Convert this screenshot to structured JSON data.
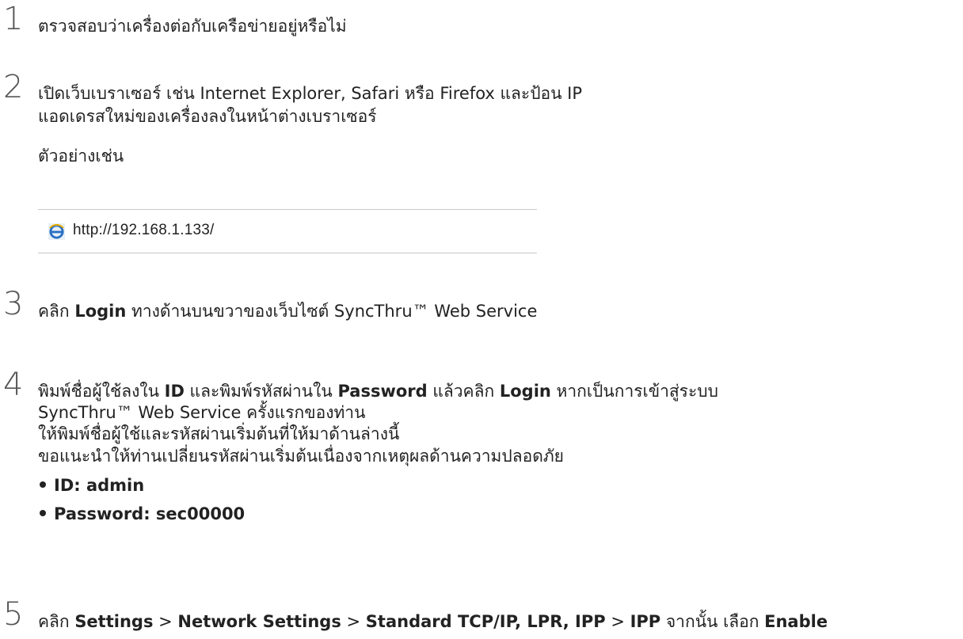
{
  "steps": [
    {
      "number": "1",
      "lines": [
        "ตรวจสอบว่าเครื่องต่อกับเครือข่ายอยู่หรือไม่"
      ]
    },
    {
      "number": "2",
      "lines": [
        "เปิดเว็บเบราเซอร์ เช่น Internet Explorer, Safari หรือ Firefox และป้อน IP",
        "แอดเดรสใหม่ของเครื่องลงในหน้าต่างเบราเซอร์",
        "ตัวอย่างเช่น"
      ]
    },
    {
      "number": "3",
      "parts": {
        "a": "คลิก ",
        "b": "Login",
        "c": " ทางด้านบนขวาของเว็บไซต์ SyncThru™ Web Service"
      }
    },
    {
      "number": "4",
      "parts": {
        "a": "พิมพ์ชื่อผู้ใช้ลงใน ",
        "b": "ID",
        "c": " และพิมพ์รหัสผ่านใน ",
        "d": "Password",
        "e": " แล้วคลิก ",
        "f": "Login",
        "g": " หากเป็นการเข้าสู่ระบบ"
      },
      "lines": [
        "SyncThru™ Web Service ครั้งแรกของท่าน",
        "ให้พิมพ์ชื่อผู้ใช้และรหัสผ่านเริ่มต้นที่ให้มาด้านล่างนี้",
        "ขอแนะนำให้ท่านเปลี่ยนรหัสผ่านเริ่มต้นเนื่องจากเหตุผลด้านความปลอดภัย"
      ],
      "bullets": [
        "ID: admin",
        "Password: sec00000"
      ]
    },
    {
      "number": "5",
      "parts": {
        "a": "คลิก ",
        "b": "Settings",
        "c": " > ",
        "d": "Network Settings",
        "e": " > ",
        "f": "Standard TCP/IP, LPR, IPP",
        "g": " > ",
        "h": "IPP",
        "i": " จากนั้น เลือก ",
        "j": "Enable"
      }
    }
  ],
  "address_bar": {
    "icon": "internet-explorer-icon",
    "url": "http://192.168.1.133/"
  }
}
